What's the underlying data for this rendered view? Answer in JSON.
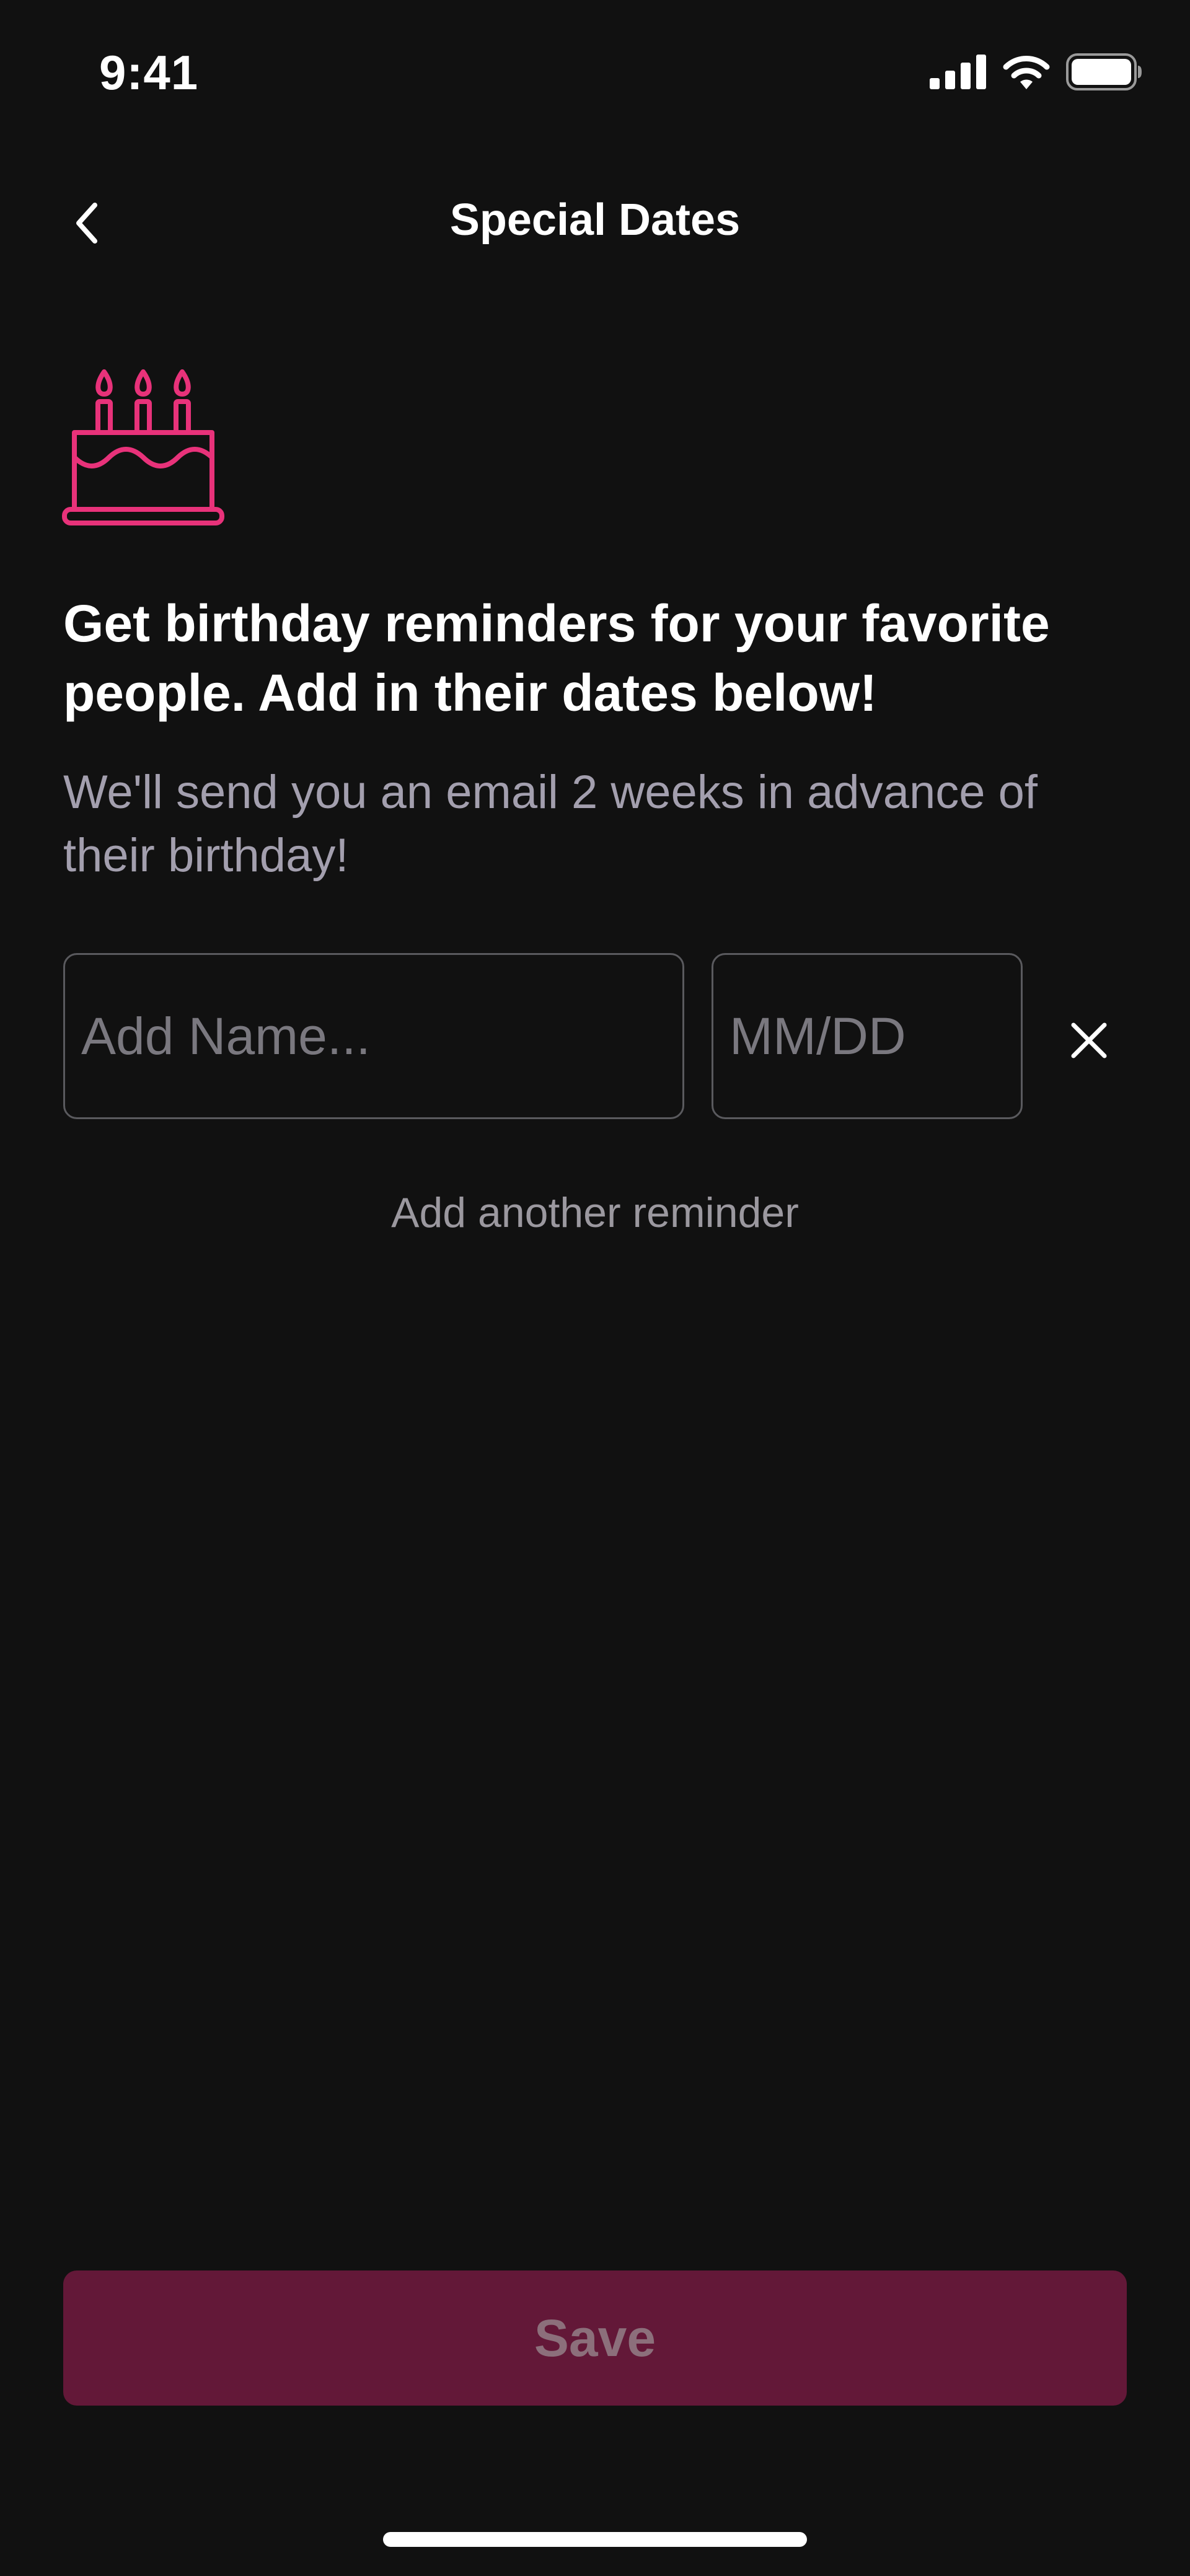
{
  "status_bar": {
    "time": "9:41",
    "icons": [
      "signal-icon",
      "wifi-icon",
      "battery-icon"
    ]
  },
  "nav": {
    "title": "Special Dates",
    "back_icon": "chevron-left-icon"
  },
  "hero": {
    "icon": "birthday-cake-icon",
    "headline": "Get birthday reminders for your favorite people. Add in their dates below!",
    "subtext": "We'll send you an email 2 weeks in advance of their birthday!"
  },
  "reminder": {
    "name_value": "",
    "name_placeholder": "Add Name...",
    "date_value": "",
    "date_placeholder": "MM/DD",
    "remove_icon": "close-icon"
  },
  "add_another_label": "Add another reminder",
  "save_label": "Save",
  "colors": {
    "background": "#111111",
    "accent_pink": "#e8327a",
    "save_button_disabled": "#631838",
    "muted_text": "#a39fae"
  }
}
